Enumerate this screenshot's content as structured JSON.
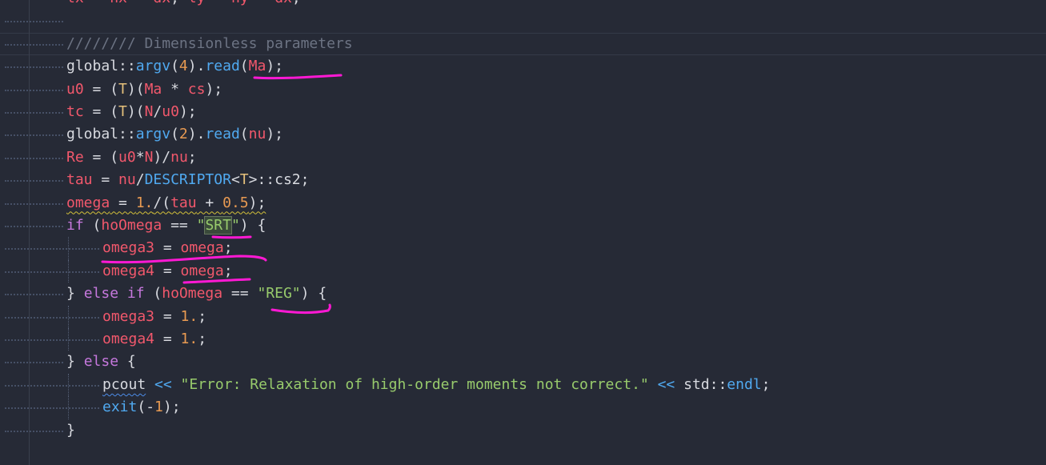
{
  "editor": {
    "language": "cpp",
    "colors": {
      "background": "#262a36",
      "comment": "#6c7383",
      "variable": "#f2586c",
      "function": "#50a9f0",
      "number": "#e89a52",
      "string": "#98cb6c",
      "type": "#e5c07b",
      "keyword": "#c678dd",
      "annotation_ink": "#ff19d4"
    },
    "lines": [
      {
        "indent": 0,
        "tokens": [
          {
            "t": "var",
            "v": "lx"
          },
          {
            "t": "op",
            "v": " = "
          },
          {
            "t": "var",
            "v": "nx"
          },
          {
            "t": "op",
            "v": " - "
          },
          {
            "t": "var",
            "v": "dx"
          },
          {
            "t": "op",
            "v": "; "
          },
          {
            "t": "var",
            "v": "ly"
          },
          {
            "t": "op",
            "v": " = "
          },
          {
            "t": "var",
            "v": "ny"
          },
          {
            "t": "op",
            "v": " - "
          },
          {
            "t": "var",
            "v": "dx"
          },
          {
            "t": "op",
            "v": ";"
          }
        ]
      },
      {
        "indent": 0,
        "tokens": []
      },
      {
        "indent": 0,
        "tokens": [
          {
            "t": "com",
            "v": "//////// Dimensionless parameters"
          }
        ]
      },
      {
        "indent": 0,
        "tokens": [
          {
            "t": "ns",
            "v": "global::"
          },
          {
            "t": "fn",
            "v": "argv"
          },
          {
            "t": "op",
            "v": "("
          },
          {
            "t": "num",
            "v": "4"
          },
          {
            "t": "op",
            "v": ")."
          },
          {
            "t": "fn",
            "v": "read"
          },
          {
            "t": "op",
            "v": "("
          },
          {
            "t": "var",
            "v": "Ma"
          },
          {
            "t": "op",
            "v": ");"
          }
        ]
      },
      {
        "indent": 0,
        "tokens": [
          {
            "t": "var",
            "v": "u0"
          },
          {
            "t": "op",
            "v": " = ("
          },
          {
            "t": "type",
            "v": "T"
          },
          {
            "t": "op",
            "v": ")("
          },
          {
            "t": "var",
            "v": "Ma"
          },
          {
            "t": "op",
            "v": " * "
          },
          {
            "t": "var",
            "v": "cs"
          },
          {
            "t": "op",
            "v": ");"
          }
        ]
      },
      {
        "indent": 0,
        "tokens": [
          {
            "t": "var",
            "v": "tc"
          },
          {
            "t": "op",
            "v": " = ("
          },
          {
            "t": "type",
            "v": "T"
          },
          {
            "t": "op",
            "v": ")("
          },
          {
            "t": "var",
            "v": "N"
          },
          {
            "t": "op",
            "v": "/"
          },
          {
            "t": "var",
            "v": "u0"
          },
          {
            "t": "op",
            "v": ");"
          }
        ]
      },
      {
        "indent": 0,
        "tokens": [
          {
            "t": "ns",
            "v": "global::"
          },
          {
            "t": "fn",
            "v": "argv"
          },
          {
            "t": "op",
            "v": "("
          },
          {
            "t": "num",
            "v": "2"
          },
          {
            "t": "op",
            "v": ")."
          },
          {
            "t": "fn",
            "v": "read"
          },
          {
            "t": "op",
            "v": "("
          },
          {
            "t": "var",
            "v": "nu"
          },
          {
            "t": "op",
            "v": ");"
          }
        ]
      },
      {
        "indent": 0,
        "tokens": [
          {
            "t": "var",
            "v": "Re"
          },
          {
            "t": "op",
            "v": " = ("
          },
          {
            "t": "var",
            "v": "u0"
          },
          {
            "t": "op",
            "v": "*"
          },
          {
            "t": "var",
            "v": "N"
          },
          {
            "t": "op",
            "v": ")/"
          },
          {
            "t": "var",
            "v": "nu"
          },
          {
            "t": "op",
            "v": ";"
          }
        ]
      },
      {
        "indent": 0,
        "tokens": [
          {
            "t": "var",
            "v": "tau"
          },
          {
            "t": "op",
            "v": " = "
          },
          {
            "t": "var",
            "v": "nu"
          },
          {
            "t": "op",
            "v": "/"
          },
          {
            "t": "fn",
            "v": "DESCRIPTOR"
          },
          {
            "t": "op",
            "v": "<"
          },
          {
            "t": "type",
            "v": "T"
          },
          {
            "t": "op",
            "v": ">::cs2;"
          }
        ]
      },
      {
        "indent": 0,
        "squiggle": "yellow",
        "tokens": [
          {
            "t": "var",
            "v": "omega"
          },
          {
            "t": "op",
            "v": " = "
          },
          {
            "t": "num",
            "v": "1."
          },
          {
            "t": "op",
            "v": "/("
          },
          {
            "t": "var",
            "v": "tau"
          },
          {
            "t": "op",
            "v": " + "
          },
          {
            "t": "num",
            "v": "0.5"
          },
          {
            "t": "op",
            "v": ");"
          }
        ]
      },
      {
        "indent": 0,
        "tokens": [
          {
            "t": "kw",
            "v": "if"
          },
          {
            "t": "op",
            "v": " ("
          },
          {
            "t": "var",
            "v": "hoOmega"
          },
          {
            "t": "op",
            "v": " == "
          },
          {
            "t": "str",
            "v": "\""
          },
          {
            "t": "strbox",
            "v": "SRT"
          },
          {
            "t": "str",
            "v": "\""
          },
          {
            "t": "op",
            "v": ") {"
          }
        ]
      },
      {
        "indent": 1,
        "tokens": [
          {
            "t": "var",
            "v": "omega3"
          },
          {
            "t": "op",
            "v": " = "
          },
          {
            "t": "var",
            "v": "omega"
          },
          {
            "t": "op",
            "v": ";"
          }
        ]
      },
      {
        "indent": 1,
        "tokens": [
          {
            "t": "var",
            "v": "omega4"
          },
          {
            "t": "op",
            "v": " = "
          },
          {
            "t": "var",
            "v": "omega"
          },
          {
            "t": "op",
            "v": ";"
          }
        ]
      },
      {
        "indent": 0,
        "tokens": [
          {
            "t": "op",
            "v": "} "
          },
          {
            "t": "kw",
            "v": "else if"
          },
          {
            "t": "op",
            "v": " ("
          },
          {
            "t": "var",
            "v": "hoOmega"
          },
          {
            "t": "op",
            "v": " == "
          },
          {
            "t": "str",
            "v": "\"REG\""
          },
          {
            "t": "op",
            "v": ") {"
          }
        ]
      },
      {
        "indent": 1,
        "tokens": [
          {
            "t": "var",
            "v": "omega3"
          },
          {
            "t": "op",
            "v": " = "
          },
          {
            "t": "num",
            "v": "1."
          },
          {
            "t": "op",
            "v": ";"
          }
        ]
      },
      {
        "indent": 1,
        "tokens": [
          {
            "t": "var",
            "v": "omega4"
          },
          {
            "t": "op",
            "v": " = "
          },
          {
            "t": "num",
            "v": "1."
          },
          {
            "t": "op",
            "v": ";"
          }
        ]
      },
      {
        "indent": 0,
        "tokens": [
          {
            "t": "op",
            "v": "} "
          },
          {
            "t": "kw",
            "v": "else"
          },
          {
            "t": "op",
            "v": " {"
          }
        ]
      },
      {
        "indent": 1,
        "tokens": [
          {
            "t": "opsq",
            "v": "pcout"
          },
          {
            "t": "fn",
            "v": " << "
          },
          {
            "t": "str",
            "v": "\"Error: Relaxation of high-order moments not correct.\""
          },
          {
            "t": "fn",
            "v": " << "
          },
          {
            "t": "ns",
            "v": "std::"
          },
          {
            "t": "fn",
            "v": "endl"
          },
          {
            "t": "op",
            "v": ";"
          }
        ]
      },
      {
        "indent": 1,
        "tokens": [
          {
            "t": "fn",
            "v": "exit"
          },
          {
            "t": "op",
            "v": "(-"
          },
          {
            "t": "num",
            "v": "1"
          },
          {
            "t": "op",
            "v": ");"
          }
        ]
      },
      {
        "indent": 0,
        "tokens": [
          {
            "t": "op",
            "v": "}"
          }
        ]
      }
    ]
  }
}
